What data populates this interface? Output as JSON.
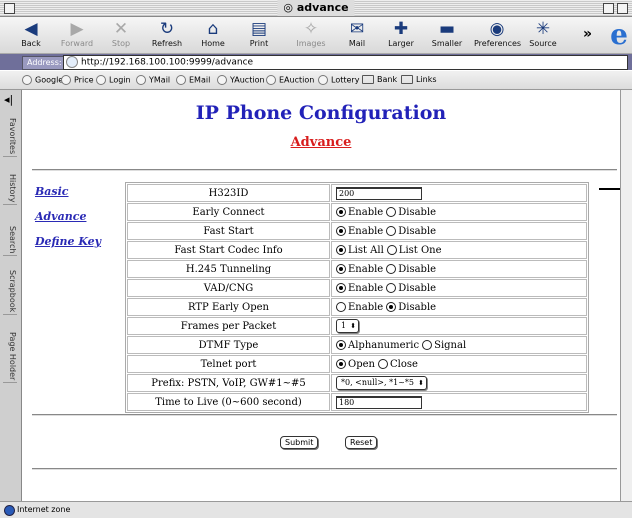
{
  "window": {
    "title": "advance"
  },
  "toolbar": {
    "buttons": [
      {
        "label": "Back",
        "icon": "back-arrow-icon"
      },
      {
        "label": "Forward",
        "icon": "forward-arrow-icon"
      },
      {
        "label": "Stop",
        "icon": "stop-icon"
      },
      {
        "label": "Refresh",
        "icon": "refresh-icon"
      },
      {
        "label": "Home",
        "icon": "home-icon"
      },
      {
        "label": "Print",
        "icon": "print-icon"
      },
      {
        "label": "Images",
        "icon": "images-icon"
      },
      {
        "label": "Mail",
        "icon": "mail-icon"
      },
      {
        "label": "Larger",
        "icon": "larger-icon"
      },
      {
        "label": "Smaller",
        "icon": "smaller-icon"
      },
      {
        "label": "Preferences",
        "icon": "preferences-icon"
      },
      {
        "label": "Source",
        "icon": "source-icon"
      }
    ]
  },
  "address": {
    "label": "Address:",
    "url": "http://192.168.100.100:9999/advance"
  },
  "favorites": [
    "Google",
    "Price",
    "Login",
    "YMail",
    "EMail",
    "YAuction",
    "EAuction",
    "Lottery",
    "Bank",
    "Links"
  ],
  "explorer_tabs": [
    "Favorites",
    "History",
    "Search",
    "Scrapbook",
    "Page Holder"
  ],
  "page": {
    "title": "IP Phone Configuration",
    "subtitle": "Advance",
    "nav": [
      "Basic",
      "Advance",
      "Define Key"
    ],
    "rows": [
      {
        "label": "H323ID",
        "type": "text",
        "value": "200"
      },
      {
        "label": "Early Connect",
        "type": "radio",
        "options": [
          "Enable",
          "Disable"
        ],
        "selected": 0
      },
      {
        "label": "Fast Start",
        "type": "radio",
        "options": [
          "Enable",
          "Disable"
        ],
        "selected": 0
      },
      {
        "label": "Fast Start Codec Info",
        "type": "radio",
        "options": [
          "List All",
          "List One"
        ],
        "selected": 0
      },
      {
        "label": "H.245 Tunneling",
        "type": "radio",
        "options": [
          "Enable",
          "Disable"
        ],
        "selected": 0
      },
      {
        "label": "VAD/CNG",
        "type": "radio",
        "options": [
          "Enable",
          "Disable"
        ],
        "selected": 0
      },
      {
        "label": "RTP Early Open",
        "type": "radio",
        "options": [
          "Enable",
          "Disable"
        ],
        "selected": 1
      },
      {
        "label": "Frames per Packet",
        "type": "select",
        "value": "1"
      },
      {
        "label": "DTMF Type",
        "type": "radio",
        "options": [
          "Alphanumeric",
          "Signal"
        ],
        "selected": 0
      },
      {
        "label": "Telnet port",
        "type": "radio",
        "options": [
          "Open",
          "Close"
        ],
        "selected": 0
      },
      {
        "label": "Prefix: PSTN, VoIP, GW#1~#5",
        "type": "select",
        "value": "*0, <null>, *1~*5"
      },
      {
        "label": "Time to Live (0~600 second)",
        "type": "text",
        "value": "180"
      }
    ],
    "submit_label": "Submit",
    "reset_label": "Reset"
  },
  "status": {
    "text": "Internet zone"
  }
}
